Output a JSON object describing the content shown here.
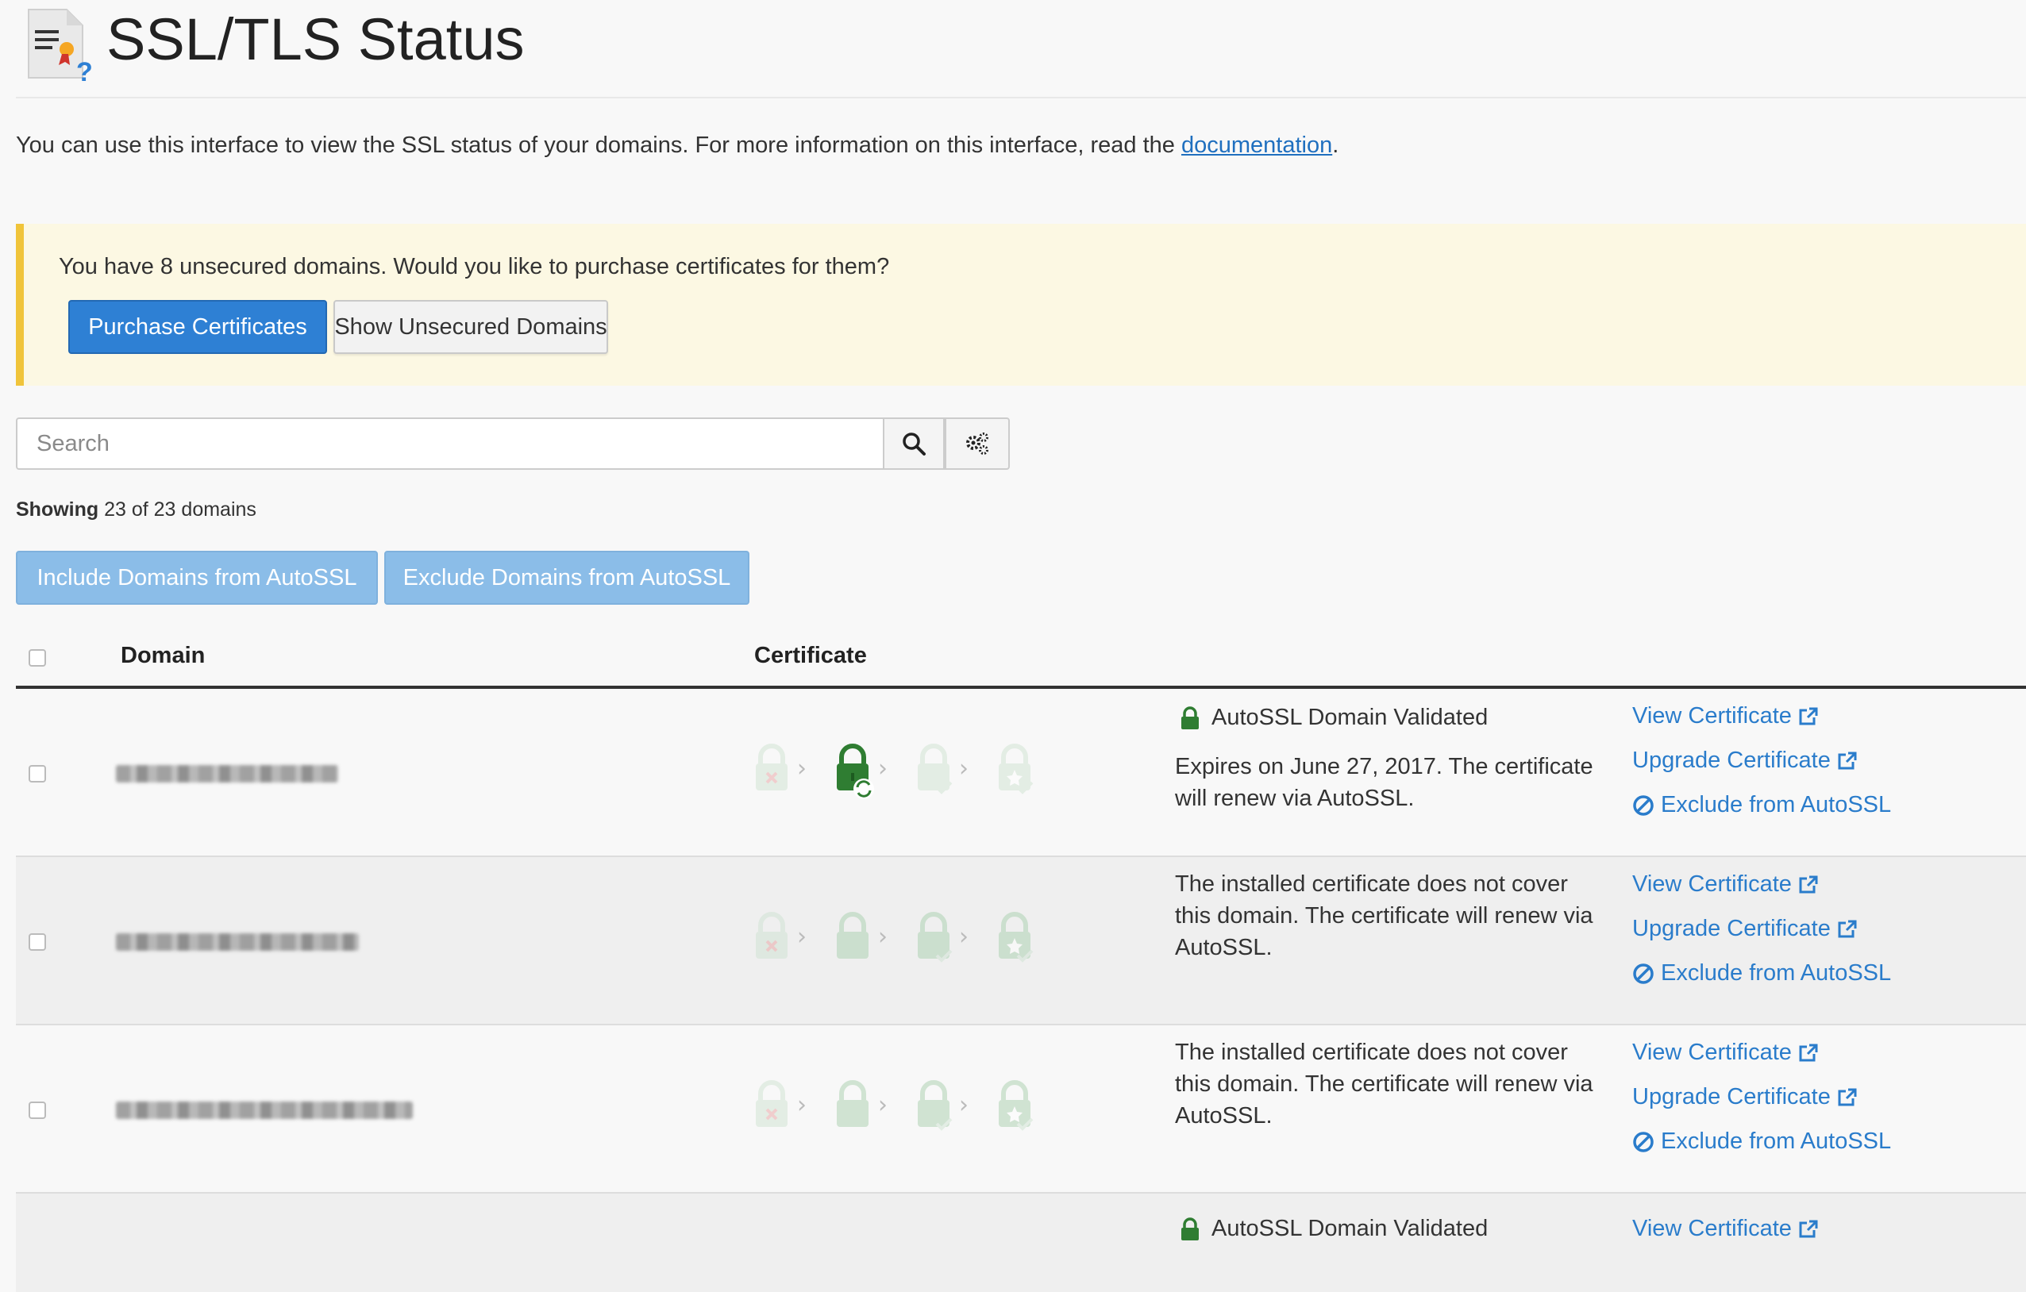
{
  "page": {
    "title": "SSL/TLS Status",
    "intro_text": "You can use this interface to view the SSL status of your domains. For more information on this interface, read the",
    "intro_link": "documentation",
    "intro_end": "."
  },
  "alert": {
    "message": "You have 8 unsecured domains. Would you like to purchase certificates for them?",
    "purchase_label": "Purchase Certificates",
    "show_unsecured_label": "Show Unsecured Domains"
  },
  "search": {
    "placeholder": "Search"
  },
  "showing": {
    "bold": "Showing",
    "rest": "23 of 23 domains"
  },
  "bulk_actions": {
    "include_label": "Include Domains from AutoSSL",
    "exclude_label": "Exclude Domains from AutoSSL"
  },
  "table": {
    "headers": {
      "domain": "Domain",
      "certificate": "Certificate"
    },
    "rows": [
      {
        "status_title": "AutoSSL Domain Validated",
        "status_text": "Expires on June 27, 2017. The certificate will renew via AutoSSL.",
        "actions": [
          "View Certificate",
          "Upgrade Certificate",
          "Exclude from AutoSSL"
        ]
      },
      {
        "status_title": "",
        "status_text": "The installed certificate does not cover this domain. The certificate will renew via AutoSSL.",
        "actions": [
          "View Certificate",
          "Upgrade Certificate",
          "Exclude from AutoSSL"
        ]
      },
      {
        "status_title": "",
        "status_text": "The installed certificate does not cover this domain. The certificate will renew via AutoSSL.",
        "actions": [
          "View Certificate",
          "Upgrade Certificate",
          "Exclude from AutoSSL"
        ]
      },
      {
        "status_title": "AutoSSL Domain Validated",
        "status_text": "",
        "actions": [
          "View Certificate"
        ]
      }
    ]
  },
  "colors": {
    "primary": "#2e80d4",
    "link": "#2a7ccb",
    "alert_bg": "#fcf8e3",
    "alert_border": "#f0c43a",
    "lock_green": "#2f7d32",
    "lock_faded_green": "#cfe3d2",
    "lock_faded_red": "#f1c9c9"
  }
}
